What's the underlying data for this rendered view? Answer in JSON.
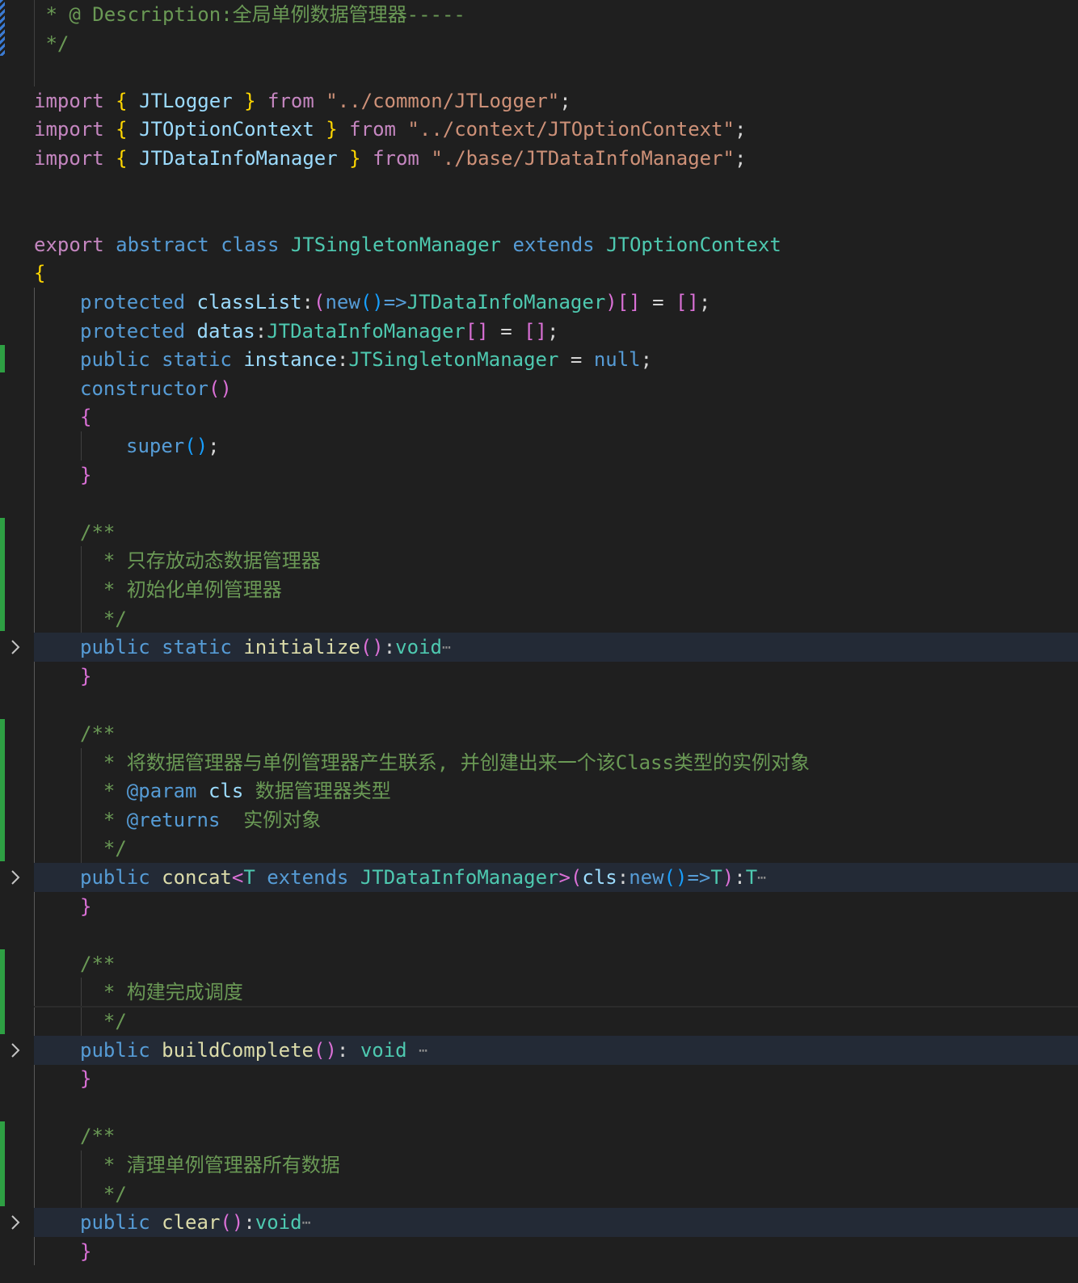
{
  "editor": {
    "colors": {
      "background": "#1f1f1f",
      "folded_background": "#232a36",
      "comment": "#6a9955",
      "keyword": "#c586c0",
      "storage": "#569cd6",
      "type": "#4ec9b0",
      "variable": "#9cdcfe",
      "function": "#dcdcaa",
      "string": "#ce9178",
      "added_gutter": "#2ea043"
    },
    "icons": {
      "fold": "chevron-right-icon",
      "fold_ellipsis": "ellipsis-icon"
    },
    "lines": [
      {
        "row": 0,
        "indent": 0,
        "tokens": [
          [
            "comment",
            " * @ Description:全局单例数据管理器-----"
          ]
        ]
      },
      {
        "row": 1,
        "indent": 0,
        "tokens": [
          [
            "comment",
            " */"
          ]
        ]
      },
      {
        "row": 3,
        "indent": 0,
        "tokens": [
          [
            "keyword",
            "import"
          ],
          [
            "plain",
            " "
          ],
          [
            "brace1",
            "{"
          ],
          [
            "plain",
            " "
          ],
          [
            "var",
            "JTLogger"
          ],
          [
            "plain",
            " "
          ],
          [
            "brace1",
            "}"
          ],
          [
            "plain",
            " "
          ],
          [
            "keyword",
            "from"
          ],
          [
            "plain",
            " "
          ],
          [
            "string",
            "\"../common/JTLogger\""
          ],
          [
            "punct",
            ";"
          ]
        ]
      },
      {
        "row": 4,
        "indent": 0,
        "tokens": [
          [
            "keyword",
            "import"
          ],
          [
            "plain",
            " "
          ],
          [
            "brace1",
            "{"
          ],
          [
            "plain",
            " "
          ],
          [
            "var",
            "JTOptionContext"
          ],
          [
            "plain",
            " "
          ],
          [
            "brace1",
            "}"
          ],
          [
            "plain",
            " "
          ],
          [
            "keyword",
            "from"
          ],
          [
            "plain",
            " "
          ],
          [
            "string",
            "\"../context/JTOptionContext\""
          ],
          [
            "punct",
            ";"
          ]
        ]
      },
      {
        "row": 5,
        "indent": 0,
        "tokens": [
          [
            "keyword",
            "import"
          ],
          [
            "plain",
            " "
          ],
          [
            "brace1",
            "{"
          ],
          [
            "plain",
            " "
          ],
          [
            "var",
            "JTDataInfoManager"
          ],
          [
            "plain",
            " "
          ],
          [
            "brace1",
            "}"
          ],
          [
            "plain",
            " "
          ],
          [
            "keyword",
            "from"
          ],
          [
            "plain",
            " "
          ],
          [
            "string",
            "\"./base/JTDataInfoManager\""
          ],
          [
            "punct",
            ";"
          ]
        ]
      },
      {
        "row": 8,
        "indent": 0,
        "tokens": [
          [
            "keyword",
            "export"
          ],
          [
            "plain",
            " "
          ],
          [
            "storage",
            "abstract"
          ],
          [
            "plain",
            " "
          ],
          [
            "storage",
            "class"
          ],
          [
            "plain",
            " "
          ],
          [
            "type",
            "JTSingletonManager"
          ],
          [
            "plain",
            " "
          ],
          [
            "storage",
            "extends"
          ],
          [
            "plain",
            " "
          ],
          [
            "type",
            "JTOptionContext"
          ]
        ]
      },
      {
        "row": 9,
        "indent": 0,
        "tokens": [
          [
            "brace1",
            "{"
          ]
        ]
      },
      {
        "row": 10,
        "indent": 1,
        "tokens": [
          [
            "storage",
            "protected"
          ],
          [
            "plain",
            " "
          ],
          [
            "var",
            "classList"
          ],
          [
            "punct",
            ":"
          ],
          [
            "brace2",
            "("
          ],
          [
            "storage",
            "new"
          ],
          [
            "brace3",
            "()"
          ],
          [
            "storage",
            "=>"
          ],
          [
            "type",
            "JTDataInfoManager"
          ],
          [
            "brace2",
            ")"
          ],
          [
            "brace2",
            "[]"
          ],
          [
            "plain",
            " "
          ],
          [
            "punct",
            "="
          ],
          [
            "plain",
            " "
          ],
          [
            "brace2",
            "[]"
          ],
          [
            "punct",
            ";"
          ]
        ]
      },
      {
        "row": 11,
        "indent": 1,
        "tokens": [
          [
            "storage",
            "protected"
          ],
          [
            "plain",
            " "
          ],
          [
            "var",
            "datas"
          ],
          [
            "punct",
            ":"
          ],
          [
            "type",
            "JTDataInfoManager"
          ],
          [
            "brace2",
            "[]"
          ],
          [
            "plain",
            " "
          ],
          [
            "punct",
            "="
          ],
          [
            "plain",
            " "
          ],
          [
            "brace2",
            "[]"
          ],
          [
            "punct",
            ";"
          ]
        ]
      },
      {
        "row": 12,
        "indent": 1,
        "tokens": [
          [
            "storage",
            "public"
          ],
          [
            "plain",
            " "
          ],
          [
            "storage",
            "static"
          ],
          [
            "plain",
            " "
          ],
          [
            "var",
            "instance"
          ],
          [
            "punct",
            ":"
          ],
          [
            "type",
            "JTSingletonManager"
          ],
          [
            "plain",
            " "
          ],
          [
            "punct",
            "="
          ],
          [
            "plain",
            " "
          ],
          [
            "storage",
            "null"
          ],
          [
            "punct",
            ";"
          ]
        ]
      },
      {
        "row": 13,
        "indent": 1,
        "tokens": [
          [
            "storage",
            "constructor"
          ],
          [
            "brace2",
            "()"
          ]
        ]
      },
      {
        "row": 14,
        "indent": 1,
        "tokens": [
          [
            "brace2",
            "{"
          ]
        ]
      },
      {
        "row": 15,
        "indent": 2,
        "tokens": [
          [
            "storage",
            "super"
          ],
          [
            "brace3",
            "()"
          ],
          [
            "punct",
            ";"
          ]
        ]
      },
      {
        "row": 16,
        "indent": 1,
        "tokens": [
          [
            "brace2",
            "}"
          ]
        ]
      },
      {
        "row": 18,
        "indent": 1,
        "tokens": [
          [
            "comment",
            "/**"
          ]
        ]
      },
      {
        "row": 19,
        "indent": 1,
        "tokens": [
          [
            "comment",
            "  * 只存放动态数据管理器"
          ]
        ]
      },
      {
        "row": 20,
        "indent": 1,
        "tokens": [
          [
            "comment",
            "  * 初始化单例管理器"
          ]
        ]
      },
      {
        "row": 21,
        "indent": 1,
        "tokens": [
          [
            "comment",
            "  */"
          ]
        ]
      },
      {
        "row": 22,
        "indent": 1,
        "folded": true,
        "tokens": [
          [
            "storage",
            "public"
          ],
          [
            "plain",
            " "
          ],
          [
            "storage",
            "static"
          ],
          [
            "plain",
            " "
          ],
          [
            "fn",
            "initialize"
          ],
          [
            "brace2",
            "()"
          ],
          [
            "punct",
            ":"
          ],
          [
            "type",
            "void"
          ]
        ],
        "ellipsis": "⋯"
      },
      {
        "row": 23,
        "indent": 1,
        "tokens": [
          [
            "brace2",
            "}"
          ]
        ]
      },
      {
        "row": 25,
        "indent": 1,
        "tokens": [
          [
            "comment",
            "/**"
          ]
        ]
      },
      {
        "row": 26,
        "indent": 1,
        "tokens": [
          [
            "comment",
            "  * 将数据管理器与单例管理器产生联系, 并创建出来一个该Class类型的实例对象"
          ]
        ]
      },
      {
        "row": 27,
        "indent": 1,
        "tokens": [
          [
            "comment",
            "  * "
          ],
          [
            "doctag",
            "@param"
          ],
          [
            "plain",
            " "
          ],
          [
            "var",
            "cls"
          ],
          [
            "comment",
            " 数据管理器类型"
          ]
        ]
      },
      {
        "row": 28,
        "indent": 1,
        "tokens": [
          [
            "comment",
            "  * "
          ],
          [
            "doctag",
            "@returns"
          ],
          [
            "comment",
            "  实例对象"
          ]
        ]
      },
      {
        "row": 29,
        "indent": 1,
        "tokens": [
          [
            "comment",
            "  */"
          ]
        ]
      },
      {
        "row": 30,
        "indent": 1,
        "folded": true,
        "tokens": [
          [
            "storage",
            "public"
          ],
          [
            "plain",
            " "
          ],
          [
            "fn",
            "concat"
          ],
          [
            "brace2",
            "<"
          ],
          [
            "type",
            "T"
          ],
          [
            "plain",
            " "
          ],
          [
            "storage",
            "extends"
          ],
          [
            "plain",
            " "
          ],
          [
            "type",
            "JTDataInfoManager"
          ],
          [
            "brace2",
            ">"
          ],
          [
            "brace2",
            "("
          ],
          [
            "var",
            "cls"
          ],
          [
            "punct",
            ":"
          ],
          [
            "storage",
            "new"
          ],
          [
            "brace3",
            "()"
          ],
          [
            "storage",
            "=>"
          ],
          [
            "type",
            "T"
          ],
          [
            "brace2",
            ")"
          ],
          [
            "punct",
            ":"
          ],
          [
            "type",
            "T"
          ]
        ],
        "ellipsis": "⋯"
      },
      {
        "row": 31,
        "indent": 1,
        "tokens": [
          [
            "brace2",
            "}"
          ]
        ]
      },
      {
        "row": 33,
        "indent": 1,
        "tokens": [
          [
            "comment",
            "/**"
          ]
        ]
      },
      {
        "row": 34,
        "indent": 1,
        "tokens": [
          [
            "comment",
            "  * 构建完成调度"
          ]
        ]
      },
      {
        "row": 35,
        "indent": 1,
        "tokens": [
          [
            "comment",
            "  */"
          ]
        ]
      },
      {
        "row": 36,
        "indent": 1,
        "folded": true,
        "tokens": [
          [
            "storage",
            "public"
          ],
          [
            "plain",
            " "
          ],
          [
            "fn",
            "buildComplete"
          ],
          [
            "brace2",
            "()"
          ],
          [
            "punct",
            ":"
          ],
          [
            "plain",
            " "
          ],
          [
            "type",
            "void"
          ],
          [
            "plain",
            " "
          ]
        ],
        "ellipsis": "⋯"
      },
      {
        "row": 37,
        "indent": 1,
        "tokens": [
          [
            "brace2",
            "}"
          ]
        ]
      },
      {
        "row": 39,
        "indent": 1,
        "tokens": [
          [
            "comment",
            "/**"
          ]
        ]
      },
      {
        "row": 40,
        "indent": 1,
        "tokens": [
          [
            "comment",
            "  * 清理单例管理器所有数据"
          ]
        ]
      },
      {
        "row": 41,
        "indent": 1,
        "tokens": [
          [
            "comment",
            "  */"
          ]
        ]
      },
      {
        "row": 42,
        "indent": 1,
        "folded": true,
        "tokens": [
          [
            "storage",
            "public"
          ],
          [
            "plain",
            " "
          ],
          [
            "fn",
            "clear"
          ],
          [
            "brace2",
            "()"
          ],
          [
            "punct",
            ":"
          ],
          [
            "type",
            "void"
          ]
        ],
        "ellipsis": "⋯"
      },
      {
        "row": 43,
        "indent": 1,
        "tokens": [
          [
            "brace2",
            "}"
          ]
        ]
      }
    ]
  }
}
